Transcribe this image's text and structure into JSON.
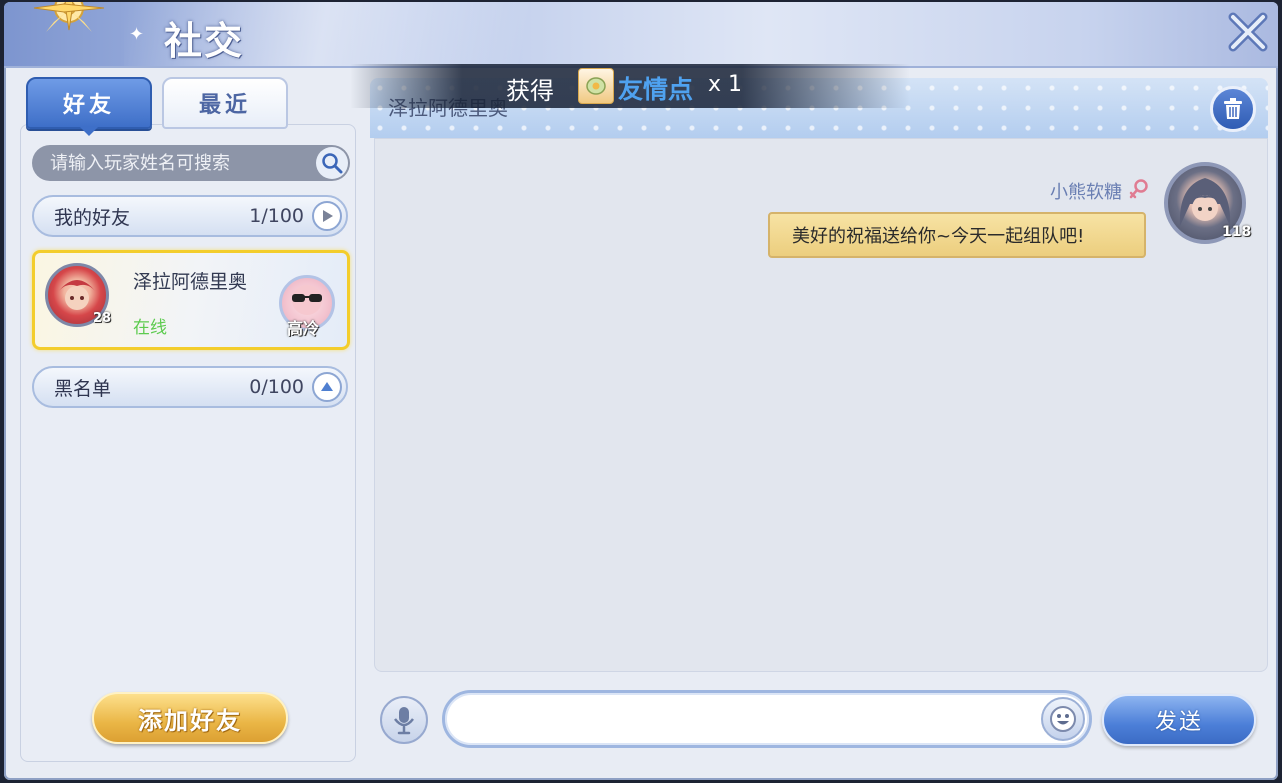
{
  "header": {
    "title": "社交"
  },
  "tabs": {
    "friends": "好友",
    "recent": "最近"
  },
  "search": {
    "placeholder": "请输入玩家姓名可搜索"
  },
  "groups": {
    "my_friends": {
      "label": "我的好友",
      "count": "1/100"
    },
    "blacklist": {
      "label": "黑名单",
      "count": "0/100"
    }
  },
  "friend": {
    "name": "泽拉阿德里奥",
    "status": "在线",
    "level": "28",
    "title_badge": "高冷"
  },
  "add_friend_label": "添加好友",
  "chat": {
    "partner_name": "泽拉阿德里奥",
    "messages": [
      {
        "sender": "小熊软糖",
        "level": "118",
        "text": "美好的祝福送给你~今天一起组队吧!"
      }
    ]
  },
  "toast": {
    "prefix": "获得",
    "item": "友情点",
    "qty": "x 1"
  },
  "input": {
    "value": "",
    "send_label": "发送"
  },
  "icons": {
    "close": "close-icon",
    "search": "search-icon",
    "trash": "trash-icon",
    "microphone": "microphone-icon",
    "emoji": "emoji-icon",
    "gender": "female-icon"
  },
  "colors": {
    "accent_blue": "#3e6fc8",
    "online_green": "#5dcb4f",
    "highlight_gold": "#f3cd2c",
    "toast_item_blue": "#4fa2f0"
  }
}
